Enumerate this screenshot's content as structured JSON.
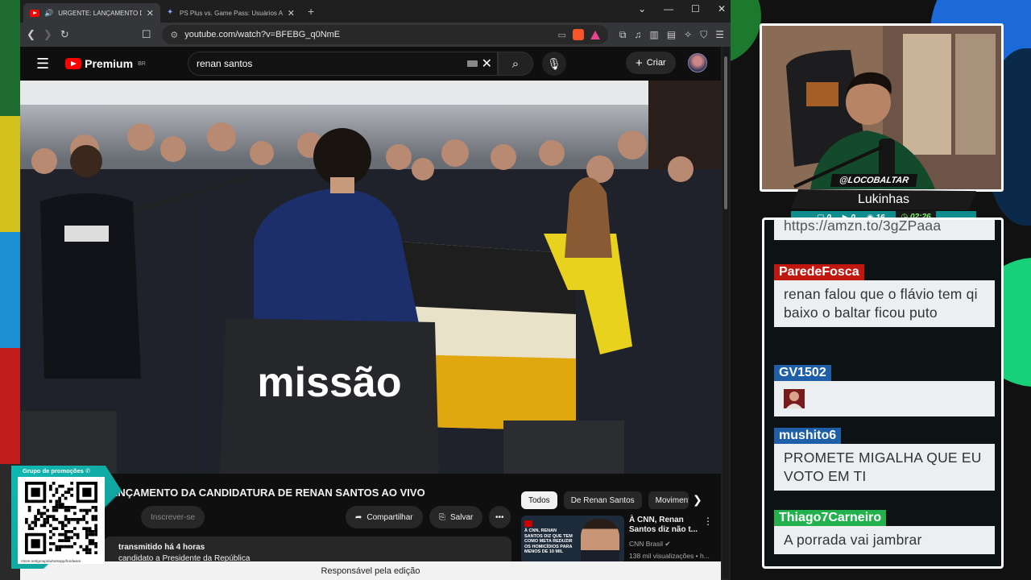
{
  "browser": {
    "tabs": [
      {
        "title": "URGENTE: LANÇAMENTO DA CANDIDATURA DE RENAN SANTOS AO VIVO",
        "active": true
      },
      {
        "title": "PS Plus vs. Game Pass: Usuários Ativos - Google Search",
        "active": false
      }
    ],
    "url": "youtube.com/watch?v=BFEBG_q0NmE"
  },
  "youtube": {
    "logo_text": "Premium",
    "logo_region": "BR",
    "search_value": "renan santos",
    "create_label": "Criar",
    "video_title": "LANÇAMENTO DA CANDIDATURA DE RENAN SANTOS AO VIVO",
    "subscribe_label": "Inscrever-se",
    "share_label": "Compartilhar",
    "save_label": "Salvar",
    "desc_line1": "transmitido há 4 horas",
    "desc_line2": "candidato a Presidente da República",
    "podium_text": "missão",
    "chips": [
      "Todos",
      "De Renan Santos",
      "Movimento"
    ],
    "recommendation": {
      "thumb_text": "À CNN, RENAN SANTOS DIZ QUE TEM COMO META REDUZIR OS HOMICÍDIOS PARA MENOS DE 10 MIL",
      "title": "À CNN, Renan Santos diz não t...",
      "channel": "CNN Brasil",
      "views": "138 mil visualizações • h..."
    },
    "bottom_notice": "Responsável pela edição"
  },
  "overlay": {
    "promo_title": "Grupo de promoções",
    "promo_url": "rstore.net/groups/whatsapp/hardware",
    "handle": "@LOCOBALTAR",
    "streamer_name": "Lukinhas",
    "stats": [
      "0",
      "0",
      "16"
    ],
    "timer": "02:26"
  },
  "chat": {
    "partial_top": "https://amzn.to/3gZPaaa",
    "messages": [
      {
        "user": "ParedeFosca",
        "color": "#c0180f",
        "text": "renan falou que o flávio tem qi baixo o baltar ficou puto"
      },
      {
        "user": "GV1502",
        "color": "#1e5fa8",
        "text": ""
      },
      {
        "user": "mushito6",
        "color": "#1e5fa8",
        "text": "PROMETE MIGALHA QUE EU VOTO EM TI"
      },
      {
        "user": "Thiago7Carneiro",
        "color": "#22b14c",
        "text": "A porrada vai jambrar"
      }
    ]
  }
}
